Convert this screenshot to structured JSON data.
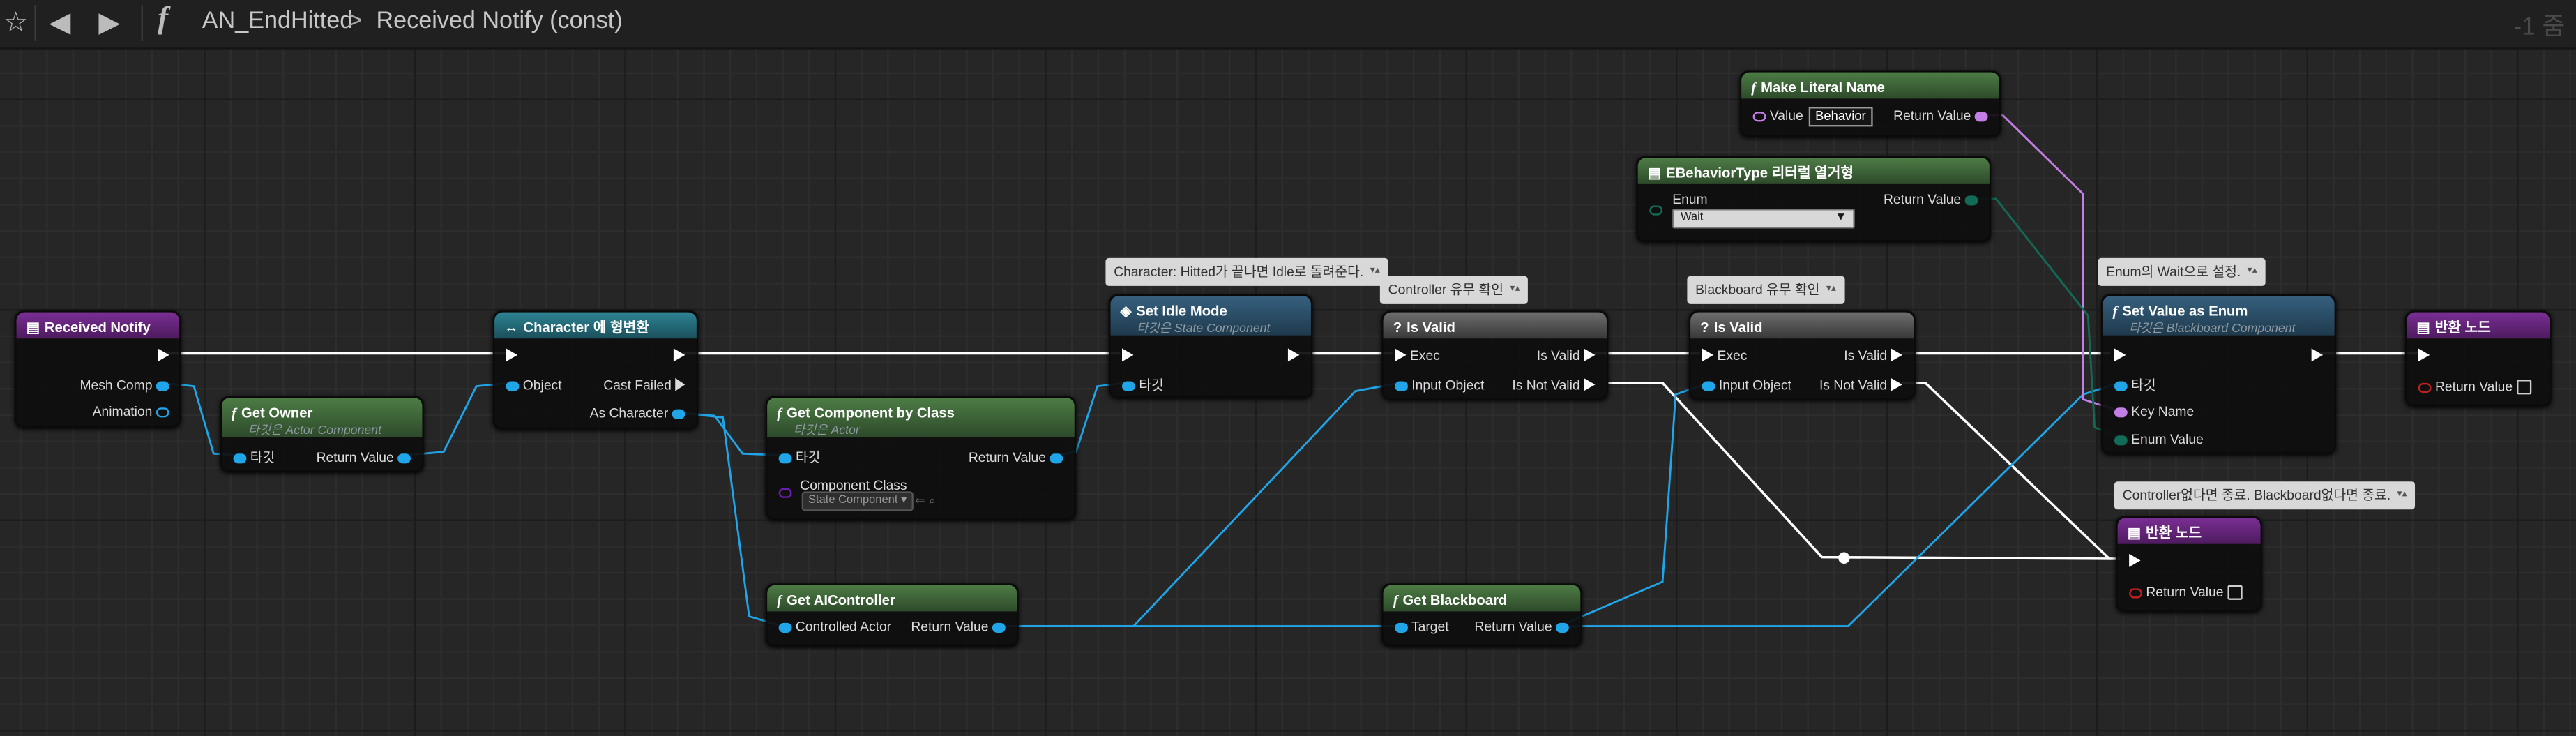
{
  "toolbar": {
    "breadcrumb_asset": "AN_EndHitted",
    "breadcrumb_separator": ">",
    "breadcrumb_function": "Received Notify (const)",
    "zoom_label": "-1 줌",
    "function_glyph": "f"
  },
  "colors": {
    "exec": "#ffffff",
    "object": "#1fa5e8",
    "name": "#c47fe6",
    "byte_enum": "#116b56",
    "class": "#6a1fb0",
    "boolean": "#9b0d0d",
    "header_function": "#3f6b3a",
    "header_entry": "#6e2785",
    "header_cast": "#236a78",
    "header_member": "#274e6b",
    "header_macro": "#595959"
  },
  "nodes": {
    "received_notify": {
      "title": "Received Notify",
      "pins": {
        "mesh_comp": "Mesh Comp",
        "animation": "Animation"
      }
    },
    "get_owner": {
      "title": "Get Owner",
      "subtitle": "타깃은 Actor Component",
      "pins": {
        "target": "타깃",
        "return": "Return Value"
      }
    },
    "cast_character": {
      "title": "Character 에 형변환",
      "pins": {
        "object": "Object",
        "cast_failed": "Cast Failed",
        "as_character": "As Character"
      }
    },
    "get_component_by_class": {
      "title": "Get Component by Class",
      "subtitle": "타깃은 Actor",
      "pins": {
        "target": "타깃",
        "component_class": "Component Class",
        "return": "Return Value"
      },
      "class_value": "State Component"
    },
    "get_ai_controller": {
      "title": "Get AIController",
      "pins": {
        "controlled_actor": "Controlled Actor",
        "return": "Return Value"
      }
    },
    "set_idle_mode": {
      "title": "Set Idle Mode",
      "subtitle": "타깃은 State Component",
      "pins": {
        "target": "타깃"
      }
    },
    "is_valid_1": {
      "title": "Is Valid",
      "pins": {
        "exec": "Exec",
        "input": "Input Object",
        "is_valid": "Is Valid",
        "is_not_valid": "Is Not Valid"
      }
    },
    "get_blackboard": {
      "title": "Get Blackboard",
      "pins": {
        "target": "Target",
        "return": "Return Value"
      }
    },
    "is_valid_2": {
      "title": "Is Valid",
      "pins": {
        "exec": "Exec",
        "input": "Input Object",
        "is_valid": "Is Valid",
        "is_not_valid": "Is Not Valid"
      }
    },
    "make_literal_name": {
      "title": "Make Literal Name",
      "pins": {
        "value": "Value",
        "return": "Return Value"
      },
      "value": "Behavior"
    },
    "enum_literal": {
      "title": "EBehaviorType 리터럴 열거형",
      "pins": {
        "enum": "Enum",
        "return": "Return Value"
      },
      "selected": "Wait"
    },
    "set_value_as_enum": {
      "title": "Set Value as Enum",
      "subtitle": "타깃은 Blackboard Component",
      "pins": {
        "target": "타깃",
        "key_name": "Key Name",
        "enum_value": "Enum Value"
      }
    },
    "return_node_1": {
      "title": "반환 노드",
      "pins": {
        "return": "Return Value"
      }
    },
    "return_node_2": {
      "title": "반환 노드",
      "pins": {
        "return": "Return Value"
      }
    }
  },
  "comments": {
    "set_idle": "Character: Hitted가 끝나면 Idle로 돌려준다.",
    "controller_check": "Controller 유무 확인",
    "blackboard_check": "Blackboard 유무 확인",
    "enum_wait": "Enum의 Wait으로 설정.",
    "end_note": "Controller없다면 종료. Blackboard없다면 종료."
  }
}
